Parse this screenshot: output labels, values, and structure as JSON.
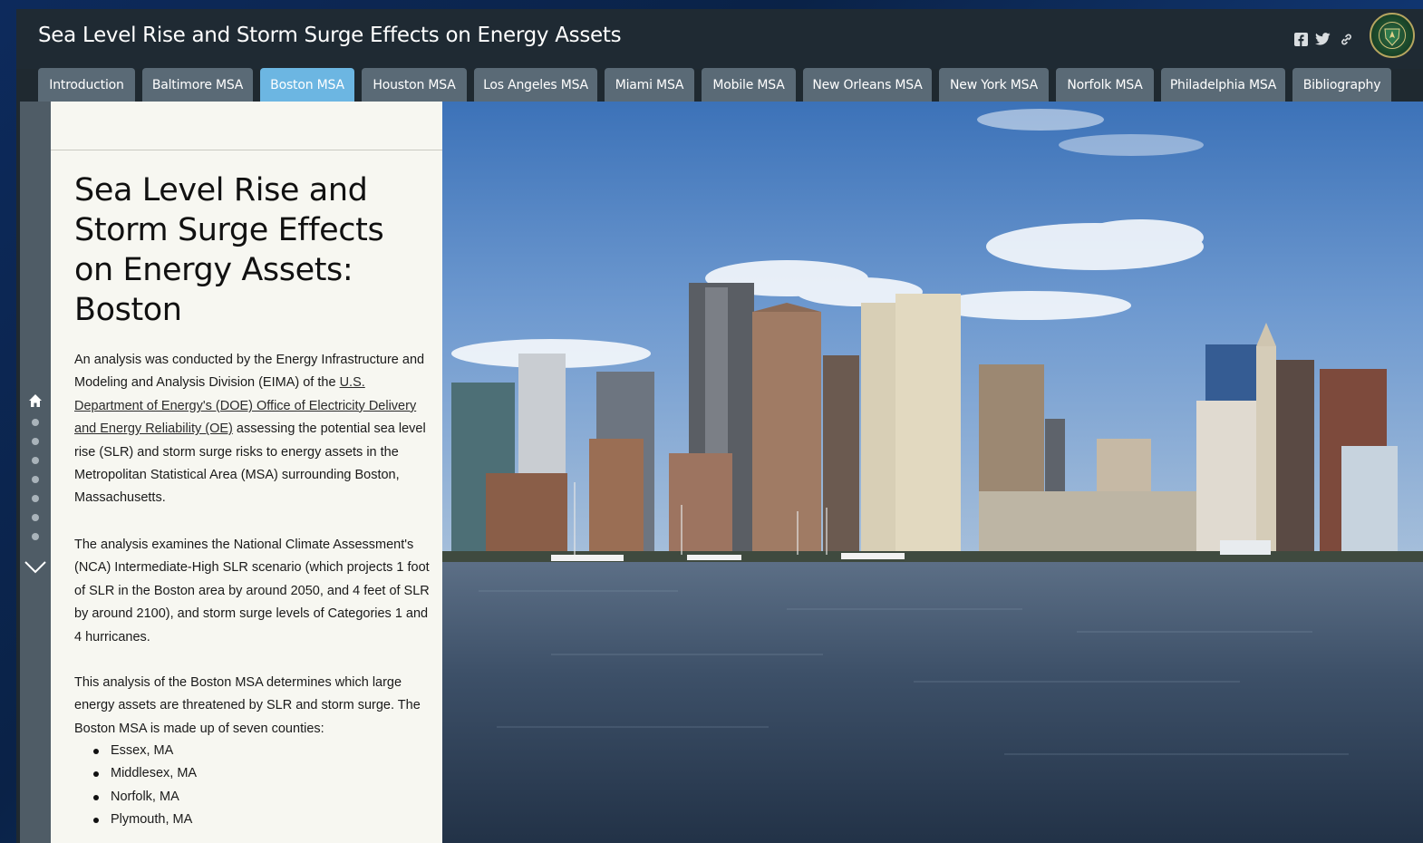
{
  "header": {
    "title": "Sea Level Rise and Storm Surge Effects on Energy Assets",
    "share_icons": [
      "facebook-icon",
      "twitter-icon",
      "link-icon"
    ],
    "logo": "doe-seal"
  },
  "tabs": [
    {
      "label": "Introduction",
      "active": false
    },
    {
      "label": "Baltimore MSA",
      "active": false
    },
    {
      "label": "Boston MSA",
      "active": true
    },
    {
      "label": "Houston MSA",
      "active": false
    },
    {
      "label": "Los Angeles MSA",
      "active": false
    },
    {
      "label": "Miami MSA",
      "active": false
    },
    {
      "label": "Mobile MSA",
      "active": false
    },
    {
      "label": "New Orleans MSA",
      "active": false
    },
    {
      "label": "New York MSA",
      "active": false
    },
    {
      "label": "Norfolk MSA",
      "active": false
    },
    {
      "label": "Philadelphia MSA",
      "active": false
    },
    {
      "label": "Bibliography",
      "active": false
    }
  ],
  "navigation": {
    "home_icon": "home-icon",
    "section_dots": 7,
    "next_icon": "chevron-down-icon"
  },
  "panel": {
    "title_lines": [
      "Sea Level Rise and",
      "Storm Surge Effects",
      "on Energy Assets:",
      "Boston"
    ],
    "p1": {
      "before": "An analysis was conducted by the Energy Infrastructure and Modeling and Analysis Division (EIMA) of the ",
      "link": "U.S. Department of Energy's (DOE) Office of Electricity Delivery and Energy Reliability (OE)",
      "after": " assessing the potential sea level rise (SLR) and storm surge risks to energy assets in the Metropolitan Statistical Area (MSA) surrounding Boston, Massachusetts."
    },
    "p2": "The analysis examines the National Climate Assessment's (NCA) Intermediate-High SLR scenario (which projects 1 foot of SLR in the Boston area by around 2050, and 4 feet of SLR by around 2100), and storm surge levels of Categories 1 and 4 hurricanes.",
    "p3": "This analysis of the Boston MSA determines which large energy assets are threatened by SLR and storm surge. The Boston MSA is made up of seven counties:",
    "counties": [
      "Essex, MA",
      "Middlesex, MA",
      "Norfolk, MA",
      "Plymouth, MA"
    ]
  },
  "hero": {
    "image": "boston-harbor-skyline-photo"
  },
  "colors": {
    "header_bg": "#1f2a33",
    "tab_bg": "#5a6a76",
    "tab_active_bg": "#6cb6e2",
    "panel_bg": "#f7f7f1",
    "rail_bg": "#4f5c66"
  }
}
